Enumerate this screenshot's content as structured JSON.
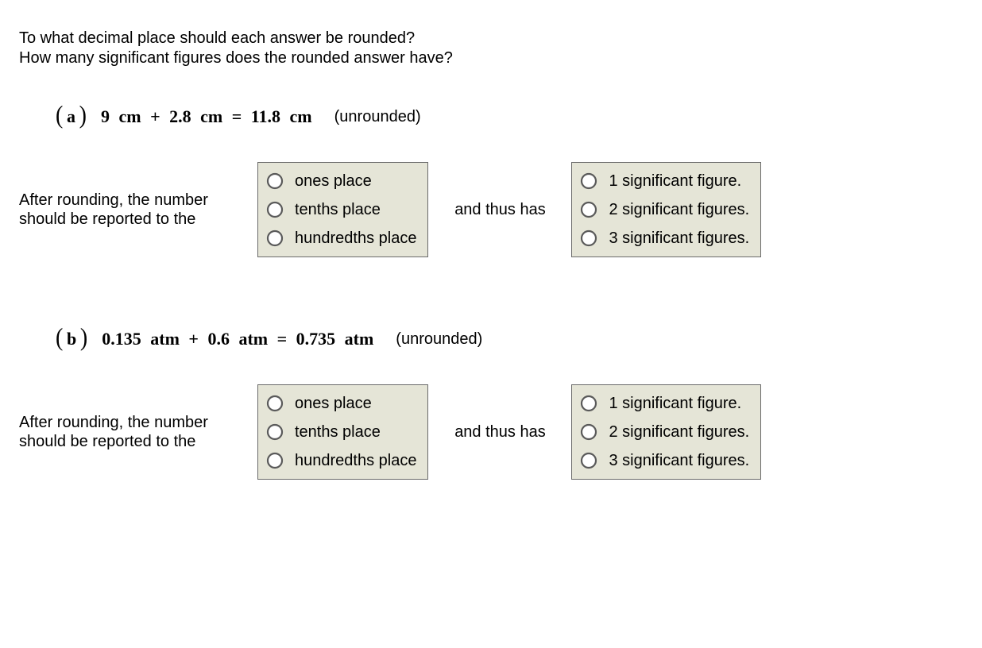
{
  "intro": {
    "line1": "To what decimal place should each answer be rounded?",
    "line2": "How many significant figures does the rounded answer have?"
  },
  "problems": [
    {
      "part": "a",
      "equation": "9   cm + 2.8   cm = 11.8   cm",
      "note": "(unrounded)",
      "lead": "After rounding, the number should be reported to the",
      "place_options": [
        "ones place",
        "tenths place",
        "hundredths place"
      ],
      "middle": "and thus has",
      "sigfig_options": [
        "1 significant figure.",
        "2 significant figures.",
        "3 significant figures."
      ]
    },
    {
      "part": "b",
      "equation": "0.135   atm + 0.6   atm = 0.735   atm",
      "note": "(unrounded)",
      "lead": "After rounding, the number should be reported to the",
      "place_options": [
        "ones place",
        "tenths place",
        "hundredths place"
      ],
      "middle": "and thus has",
      "sigfig_options": [
        "1 significant figure.",
        "2 significant figures.",
        "3 significant figures."
      ]
    }
  ]
}
